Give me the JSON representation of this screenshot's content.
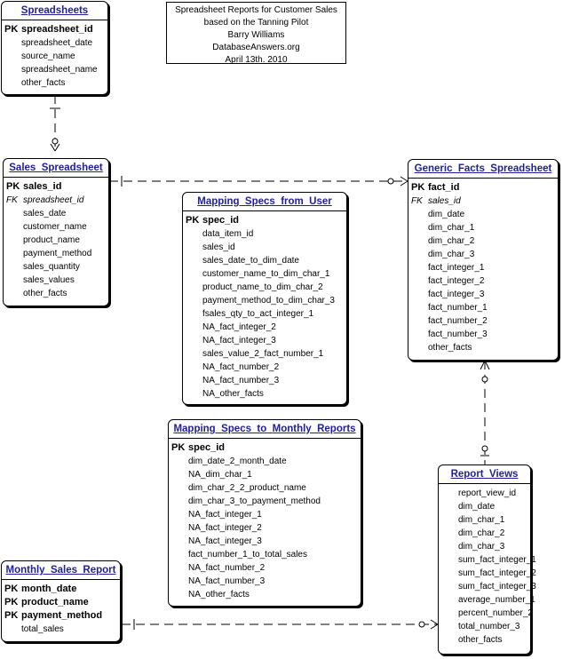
{
  "note": {
    "lines": [
      "Spreadsheet Reports for Customer Sales",
      "based on the Tanning Pilot",
      "Barry Williams",
      "DatabaseAnswers.org",
      "April 13th. 2010"
    ]
  },
  "entities": {
    "spreadsheets": {
      "title": "Spreadsheets",
      "keys": [
        {
          "tag": "PK",
          "name": "spreadsheet_id"
        }
      ],
      "fields": [
        "spreadsheet_date",
        "source_name",
        "spreadsheet_name",
        "other_facts"
      ]
    },
    "sales_spreadsheet": {
      "title": "Sales_Spreadsheet",
      "keys": [
        {
          "tag": "PK",
          "name": "sales_id"
        },
        {
          "tag": "FK",
          "name": "spreadsheet_id"
        }
      ],
      "fields": [
        "sales_date",
        "customer_name",
        "product_name",
        "payment_method",
        "sales_quantity",
        "sales_values",
        "other_facts"
      ]
    },
    "generic_facts": {
      "title": "Generic_Facts_Spreadsheet",
      "keys": [
        {
          "tag": "PK",
          "name": "fact_id"
        },
        {
          "tag": "FK",
          "name": "sales_id"
        }
      ],
      "fields": [
        "dim_date",
        "dim_char_1",
        "dim_char_2",
        "dim_char_3",
        "fact_integer_1",
        "fact_integer_2",
        "fact_integer_3",
        "fact_number_1",
        "fact_number_2",
        "fact_number_3",
        "other_facts"
      ]
    },
    "mapping_user": {
      "title": "Mapping_Specs_from_User",
      "keys": [
        {
          "tag": "PK",
          "name": "spec_id"
        }
      ],
      "fields": [
        "data_item_id",
        "sales_id",
        "sales_date_to_dim_date",
        "customer_name_to_dim_char_1",
        "product_name_to_dim_char_2",
        "payment_method_to_dim_char_3",
        "fsales_qty_to_act_integer_1",
        "NA_fact_integer_2",
        "NA_fact_integer_3",
        "sales_value_2_fact_number_1",
        "NA_fact_number_2",
        "NA_fact_number_3",
        "NA_other_facts"
      ]
    },
    "mapping_monthly": {
      "title": "Mapping_Specs_to_Monthly_Reports",
      "keys": [
        {
          "tag": "PK",
          "name": "spec_id"
        }
      ],
      "fields": [
        "dim_date_2_month_date",
        "NA_dim_char_1",
        "dim_char_2_2_product_name",
        "dim_char_3_to_payment_method",
        "NA_fact_integer_1",
        "NA_fact_integer_2",
        "NA_fact_integer_3",
        "fact_number_1_to_total_sales",
        "NA_fact_number_2",
        "NA_fact_number_3",
        "NA_other_facts"
      ]
    },
    "report_views": {
      "title": "Report_Views",
      "keys": [],
      "fields": [
        "report_view_id",
        "dim_date",
        "dim_char_1",
        "dim_char_2",
        "dim_char_3",
        "sum_fact_integer_1",
        "sum_fact_integer_2",
        "sum_fact_integer_3",
        "average_number_1",
        "percent_number_2",
        "total_number_3",
        "other_facts"
      ]
    },
    "monthly_sales": {
      "title": "Monthly_Sales_Report",
      "keys": [
        {
          "tag": "PK",
          "name": "month_date"
        },
        {
          "tag": "PK",
          "name": "product_name"
        },
        {
          "tag": "PK",
          "name": "payment_method"
        }
      ],
      "fields": [
        "total_sales"
      ]
    }
  }
}
